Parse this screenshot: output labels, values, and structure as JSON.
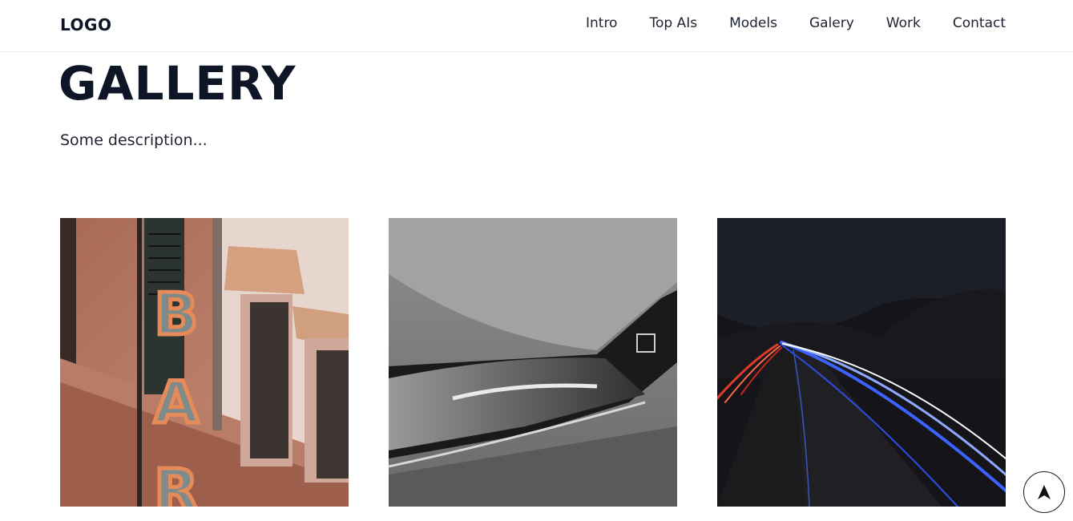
{
  "header": {
    "logo": "LOGO",
    "nav": [
      "Intro",
      "Top AIs",
      "Models",
      "Galery",
      "Work",
      "Contact"
    ]
  },
  "main": {
    "title": "GALLERY",
    "description": "Some description..."
  },
  "gallery": {
    "items": [
      {
        "subject": "bar-sign-building",
        "sign_letters": [
          "B",
          "A",
          "R"
        ]
      },
      {
        "subject": "car-headlight"
      },
      {
        "subject": "night-highway-light-trails"
      }
    ]
  },
  "controls": {
    "scroll_top_icon": "arrow-up-icon"
  },
  "colors": {
    "text_dark": "#0d1526",
    "nav_text": "#1e2233",
    "divider": "#ececec"
  }
}
